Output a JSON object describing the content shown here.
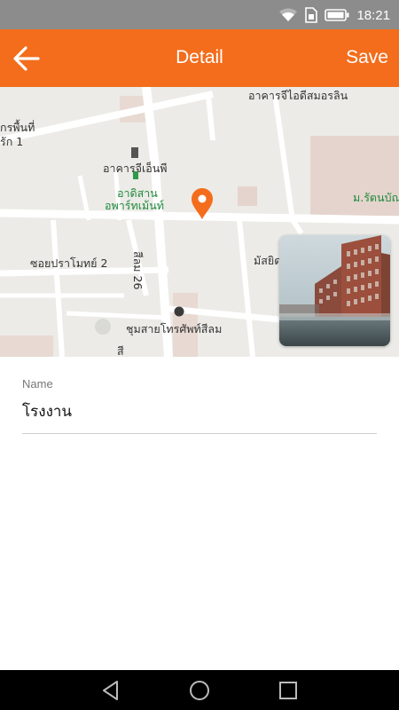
{
  "status_bar": {
    "time": "18:21",
    "icons": [
      "wifi-icon",
      "sim-icon",
      "battery-icon"
    ]
  },
  "app_bar": {
    "title": "Detail",
    "save_label": "Save",
    "back_icon": "arrow-left-icon",
    "color": "#f36d1c"
  },
  "map": {
    "labels": {
      "building_top": "อาคารจีไอดีสมอรลิน",
      "top_left_1": "กรพื้นที่",
      "top_left_2": "รัก 1",
      "building_mid": "อาคารจีเอ็นพี",
      "park_1": "อาดิสาน",
      "park_2": "อพาร์ทเม้นท์",
      "right_green": "ม.รัตนบัณ",
      "soi": "ซอยปราโมทย์ 2",
      "road": "สีลม 26",
      "right_mid": "มัสยิด",
      "exchange": "ชุมสายโทรศัพท์สีลม",
      "bottom_small": "สี"
    },
    "pin_icon": "map-pin-icon"
  },
  "photo": {
    "icon": "building-photo-thumbnail"
  },
  "form": {
    "name_label": "Name",
    "name_value": "โรงงาน"
  },
  "nav_bar": {
    "icons": [
      "back-triangle-icon",
      "home-circle-icon",
      "recents-square-icon"
    ]
  }
}
